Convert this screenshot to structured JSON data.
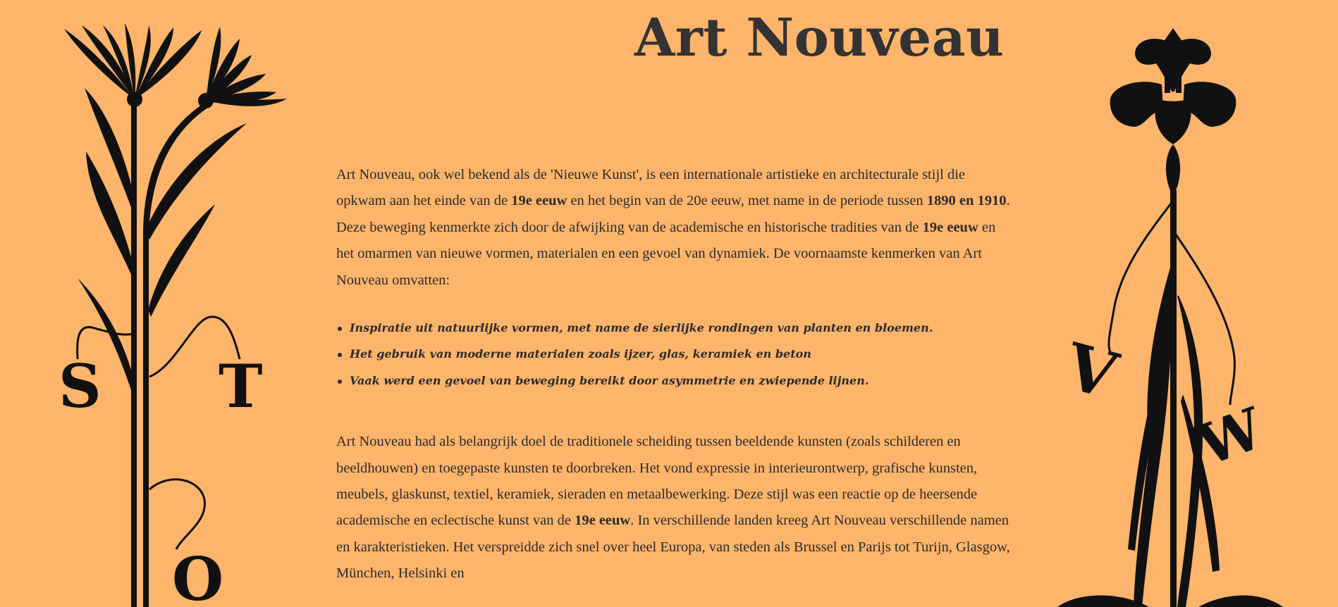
{
  "page": {
    "title": "Art Nouveau"
  },
  "intro": {
    "t1": "Art Nouveau, ook wel bekend als de 'Nieuwe Kunst', is een internationale artistieke en architecturale stijl die opkwam aan het einde van de ",
    "b1": "19e eeuw",
    "t2": " en het begin van de 20e eeuw, met name in de periode tussen ",
    "b2": "1890 en 1910",
    "t3": ". Deze beweging kenmerkte zich door de afwijking van de academische en historische tradities van de ",
    "b3": "19e eeuw",
    "t4": " en het omarmen van nieuwe vormen, materialen en een gevoel van dynamiek. De voornaamste kenmerken van Art Nouveau omvatten:"
  },
  "features": [
    "Inspiratie uit natuurlijke vormen, met name de sierlijke rondingen van planten en bloemen.",
    "Het gebruik van moderne materialen zoals ijzer, glas, keramiek en beton",
    "Vaak werd een gevoel van beweging bereikt door asymmetrie en zwiepende lijnen."
  ],
  "body": {
    "t1": "Art Nouveau had als belangrijk doel de traditionele scheiding tussen beeldende kunsten (zoals schilderen en beeldhouwen) en toegepaste kunsten te doorbreken. Het vond expressie in interieurontwerp, grafische kunsten, meubels, glaskunst, textiel, keramiek, sieraden en metaalbewerking. Deze stijl was een reactie op de heersende academische en eclectische kunst van de ",
    "b1": "19e eeuw",
    "t2": ". In verschillende landen kreeg Art Nouveau verschillende namen en karakteristieken. Het verspreidde zich snel over heel Europa, van steden als Brussel en Parijs tot Turijn, Glasgow, München, Helsinki en"
  },
  "decorations": {
    "left_letters": [
      "S",
      "T",
      "O"
    ],
    "right_letters": [
      "V",
      "W"
    ],
    "ink_color": "#111111",
    "background_color": "#FDB46B"
  }
}
